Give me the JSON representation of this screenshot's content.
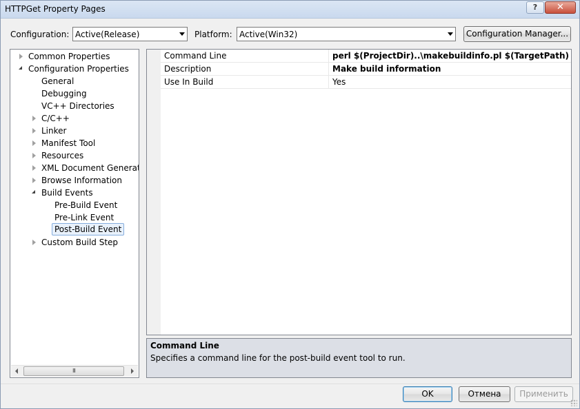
{
  "window": {
    "title": "HTTPGet Property Pages"
  },
  "toolbar": {
    "configuration_label": "Configuration:",
    "configuration_value": "Active(Release)",
    "platform_label": "Platform:",
    "platform_value": "Active(Win32)",
    "config_manager_label": "Configuration Manager..."
  },
  "tree": {
    "items": [
      {
        "label": "Common Properties"
      },
      {
        "label": "Configuration Properties"
      },
      {
        "label": "General"
      },
      {
        "label": "Debugging"
      },
      {
        "label": "VC++ Directories"
      },
      {
        "label": "C/C++"
      },
      {
        "label": "Linker"
      },
      {
        "label": "Manifest Tool"
      },
      {
        "label": "Resources"
      },
      {
        "label": "XML Document Generator"
      },
      {
        "label": "Browse Information"
      },
      {
        "label": "Build Events"
      },
      {
        "label": "Pre-Build Event"
      },
      {
        "label": "Pre-Link Event"
      },
      {
        "label": "Post-Build Event"
      },
      {
        "label": "Custom Build Step"
      }
    ],
    "selected": "Post-Build Event",
    "scroll_thumb": "III"
  },
  "properties": [
    {
      "name": "Command Line",
      "value": "perl $(ProjectDir)..\\makebuildinfo.pl $(TargetPath)"
    },
    {
      "name": "Description",
      "value": "Make build information"
    },
    {
      "name": "Use In Build",
      "value": "Yes"
    }
  ],
  "description": {
    "title": "Command Line",
    "text": "Specifies a command line for the post-build event tool to run."
  },
  "buttons": {
    "ok": "OK",
    "cancel": "Отмена",
    "apply": "Применить"
  },
  "colors": {
    "selection_bg": "#e8f1fb",
    "selection_border": "#84acdd",
    "description_bg": "#dcdfe6",
    "close_button": "#c8503c"
  }
}
